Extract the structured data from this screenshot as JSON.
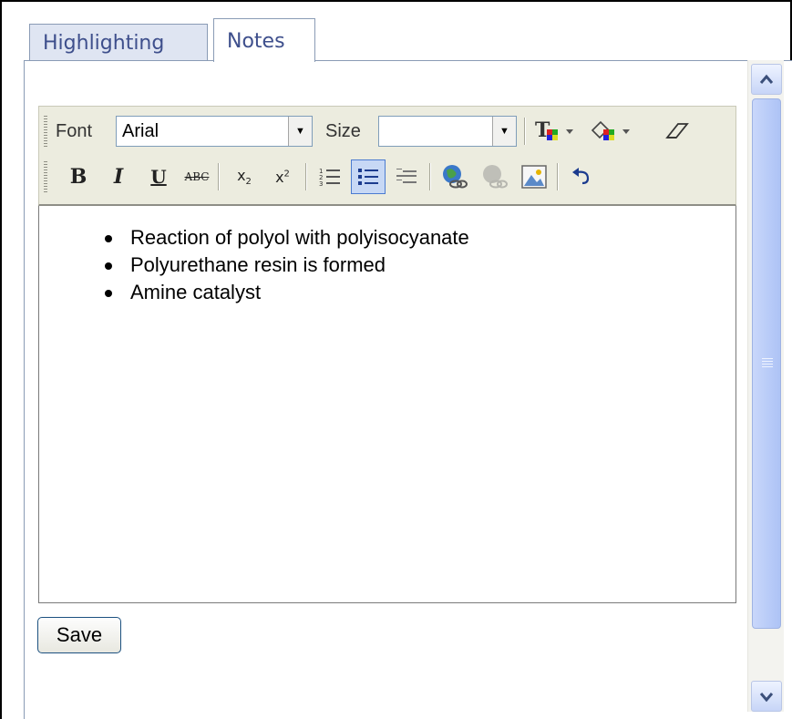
{
  "tabs": [
    {
      "label": "Highlighting",
      "active": false
    },
    {
      "label": "Notes",
      "active": true
    }
  ],
  "toolbar": {
    "font_label": "Font",
    "font_value": "Arial",
    "size_label": "Size",
    "size_value": "",
    "buttons_row1": [
      "text-color",
      "background-color",
      "remove-format"
    ],
    "buttons_row2": [
      "bold",
      "italic",
      "underline",
      "strikethrough",
      "subscript",
      "superscript",
      "numbered-list",
      "bulleted-list",
      "definition-list",
      "insert-link",
      "remove-link",
      "insert-image",
      "undo"
    ],
    "active_button": "bulleted-list",
    "bold_glyph": "B",
    "italic_glyph": "I",
    "underline_glyph": "U",
    "strike_glyph": "ABC",
    "sub_glyph": "x",
    "sub_script": "2",
    "sup_glyph": "x",
    "sup_script": "2"
  },
  "editor": {
    "items": [
      "Reaction of polyol with polyisocyanate",
      "Polyurethane resin is formed",
      "Amine catalyst"
    ]
  },
  "save_label": "Save",
  "colors": {
    "tab_text": "#3e4f8c",
    "toolbar_bg": "#ececdf",
    "scrollbar_thumb": "#b8cbf8",
    "active_button_bg": "#c7d8f5"
  }
}
